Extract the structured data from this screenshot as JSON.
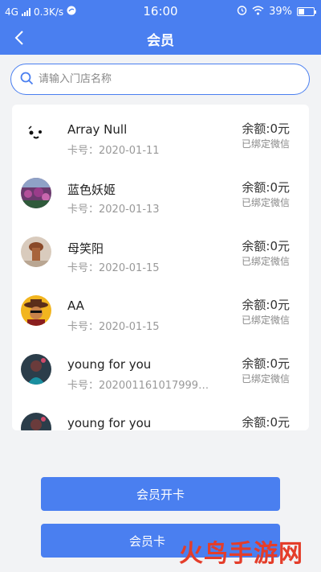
{
  "status_bar": {
    "network": "4G",
    "speed": "0.3K/s",
    "time": "16:00",
    "battery": "39%",
    "icons": [
      "signal-icon",
      "data-saver-icon",
      "alarm-icon",
      "wifi-icon",
      "battery-icon"
    ]
  },
  "header": {
    "title": "会员",
    "back_icon": "chevron-left-icon",
    "background_color": "#4a7ff0"
  },
  "search": {
    "placeholder": "请输入门店名称",
    "value": "",
    "icon": "search-icon"
  },
  "members": [
    {
      "name": "Array Null",
      "card": "卡号：2020-01-11",
      "balance": "余额:0元",
      "status": "已绑定微信",
      "avatar": "dog-face-avatar"
    },
    {
      "name": "蓝色妖姬",
      "card": "卡号：2020-01-13",
      "balance": "余额:0元",
      "status": "已绑定微信",
      "avatar": "flower-field-avatar"
    },
    {
      "name": "母笑阳",
      "card": "卡号：2020-01-15",
      "balance": "余额:0元",
      "status": "已绑定微信",
      "avatar": "brown-photo-avatar"
    },
    {
      "name": "AA",
      "card": "卡号：2020-01-15",
      "balance": "余额:0元",
      "status": "已绑定微信",
      "avatar": "cowboy-cartoon-avatar"
    },
    {
      "name": "young for you",
      "card": "卡号：20200116101799992…",
      "balance": "余额:0元",
      "status": "已绑定微信",
      "avatar": "dark-portrait-avatar"
    },
    {
      "name": "young for you",
      "card": "",
      "balance": "余额:0元",
      "status": "",
      "avatar": "dark-portrait-avatar"
    }
  ],
  "buttons": {
    "open_card": "会员开卡",
    "second_partial": "会员卡"
  },
  "watermark": "火鸟手游网"
}
